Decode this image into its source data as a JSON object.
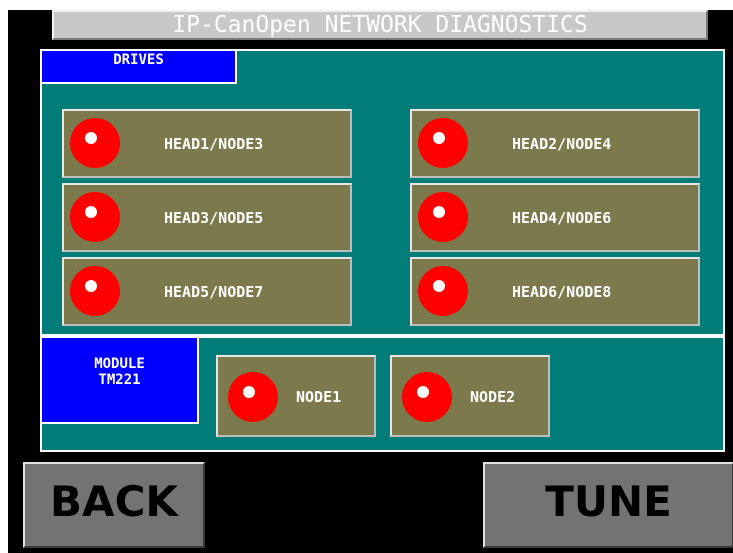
{
  "header": {
    "title": "IP-CanOpen NETWORK DIAGNOSTICS"
  },
  "drives": {
    "tab_label": "DRIVES",
    "nodes": [
      {
        "label": "HEAD1/NODE3",
        "status_color": "#ff0000"
      },
      {
        "label": "HEAD2/NODE4",
        "status_color": "#ff0000"
      },
      {
        "label": "HEAD3/NODE5",
        "status_color": "#ff0000"
      },
      {
        "label": "HEAD4/NODE6",
        "status_color": "#ff0000"
      },
      {
        "label": "HEAD5/NODE7",
        "status_color": "#ff0000"
      },
      {
        "label": "HEAD6/NODE8",
        "status_color": "#ff0000"
      }
    ]
  },
  "module": {
    "tab_line1": "MODULE",
    "tab_line2": "TM221",
    "nodes": [
      {
        "label": "NODE1",
        "status_color": "#ff0000"
      },
      {
        "label": "NODE2",
        "status_color": "#ff0000"
      }
    ]
  },
  "footer": {
    "back_label": "BACK",
    "tune_label": "TUNE"
  },
  "colors": {
    "panel_bg": "#007d78",
    "tab_bg": "#0000ff",
    "node_bg": "#7c7a4d",
    "led_fault": "#ff0000",
    "screen_bg": "#000000"
  },
  "icons": {
    "status_led": "status-led-icon"
  }
}
